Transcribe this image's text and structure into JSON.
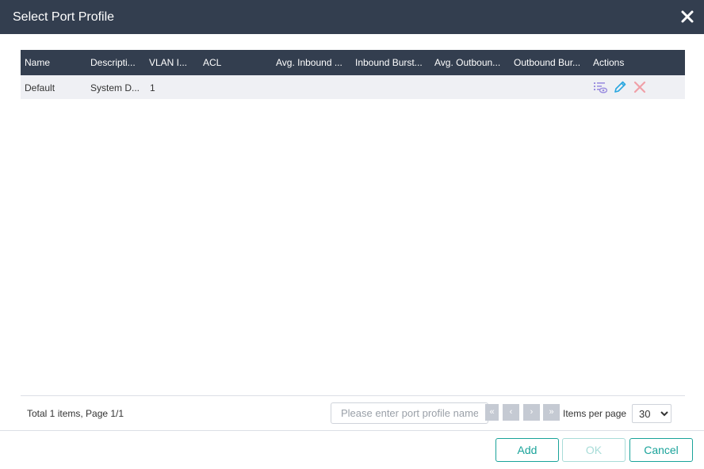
{
  "dialog": {
    "title": "Select Port Profile"
  },
  "table": {
    "columns": [
      "Name",
      "Descripti...",
      "VLAN I...",
      "ACL",
      "Avg. Inbound ...",
      "Inbound Burst...",
      "Avg. Outboun...",
      "Outbound Bur...",
      "Actions"
    ],
    "rows": [
      {
        "name": "Default",
        "description": "System D...",
        "vlan": "1",
        "acl": "",
        "avg_inbound": "",
        "inbound_burst": "",
        "avg_outbound": "",
        "outbound_burst": ""
      }
    ],
    "action_icons": [
      "view-details-icon",
      "edit-icon",
      "delete-icon"
    ]
  },
  "footer": {
    "info": "Total 1 items, Page 1/1",
    "search_placeholder": "Please enter port profile name",
    "search_value": "",
    "items_per_page_label": "Items per page",
    "items_per_page": "30",
    "items_per_page_options": [
      "30"
    ],
    "pager": {
      "first": "«",
      "prev": "‹",
      "next": "›",
      "last": "»"
    }
  },
  "buttons": {
    "add": "Add",
    "ok": "OK",
    "cancel": "Cancel"
  },
  "colors": {
    "header_bg": "#333e4f",
    "row_bg": "#eff0f4",
    "accent": "#1aa39a",
    "accent_disabled": "#a8dcd8",
    "view_icon": "#9b8ee0",
    "edit_icon": "#2aa7e0",
    "delete_icon": "#f0a0a8"
  }
}
